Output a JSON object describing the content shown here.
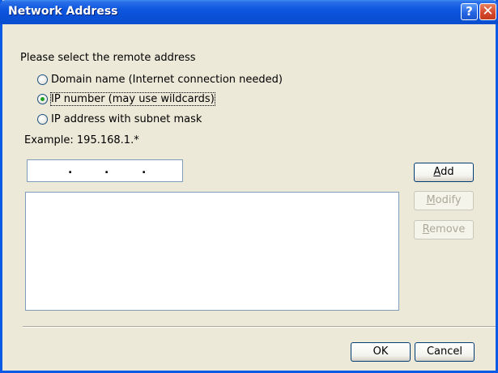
{
  "window": {
    "title": "Network Address",
    "help_glyph": "?",
    "close_glyph": "✕"
  },
  "form": {
    "prompt": "Please select the remote address",
    "options": [
      {
        "label": "Domain name (Internet connection needed)",
        "selected": false
      },
      {
        "label": "IP number (may use wildcards)",
        "selected": true
      },
      {
        "label": "IP address with subnet mask",
        "selected": false
      }
    ],
    "example": "Example: 195.168.1.*",
    "ip_input": {
      "value": ". . ."
    },
    "list_items": []
  },
  "buttons": {
    "add": {
      "accel": "A",
      "rest": "dd",
      "enabled": true
    },
    "modify": {
      "accel": "M",
      "rest": "odify",
      "enabled": false
    },
    "remove": {
      "accel": "R",
      "rest": "emove",
      "enabled": false
    },
    "ok": "OK",
    "cancel": "Cancel"
  },
  "colors": {
    "titlebar": "#0b55db",
    "dialog_bg": "#ece9d8",
    "radio_selected": "#21a121"
  },
  "icons": {
    "help": "question-mark",
    "close": "x-mark"
  }
}
